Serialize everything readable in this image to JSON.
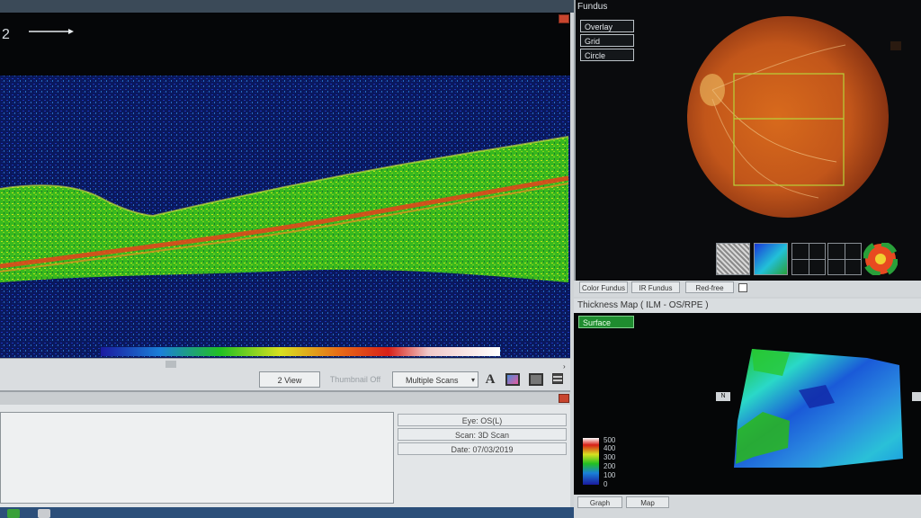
{
  "oct": {
    "scan_number": "2",
    "scan_arrow": "arrow-right-icon"
  },
  "toolbar": {
    "view_label": "2 View",
    "thumbnail_label": "Thumbnail Off",
    "scans_select": "Multiple Scans",
    "font_icon_label": "A"
  },
  "fundus": {
    "title": "Fundus",
    "buttons": [
      "Overlay",
      "Grid",
      "Circle"
    ],
    "tabs": [
      "Color Fundus",
      "IR Fundus",
      "Red-free"
    ]
  },
  "thickness": {
    "title": "Thickness Map ( ILM - OS/RPE )",
    "surface_label": "Surface",
    "scale": [
      "500",
      "400",
      "300",
      "200",
      "100",
      "0"
    ],
    "direction_marker": "N",
    "tabs": [
      "Graph",
      "Map"
    ]
  },
  "info": {
    "eye": "Eye: OS(L)",
    "scan": "Scan: 3D Scan",
    "date": "Date: 07/03/2019"
  },
  "colors": {
    "retina_green": "#2fc21a",
    "rpe_red": "#e8401c",
    "fundus_orange": "#c85a1a",
    "grid_line": "#b8d23a"
  }
}
